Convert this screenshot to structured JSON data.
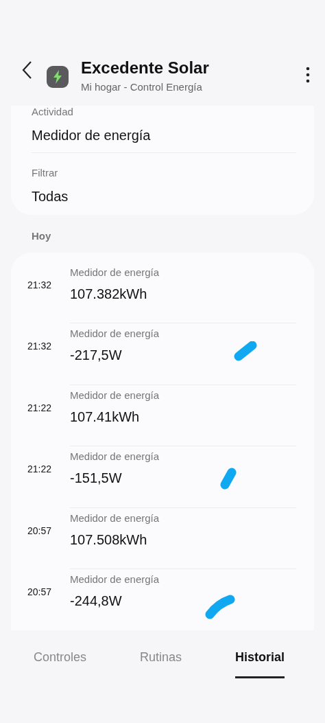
{
  "header": {
    "title": "Excedente Solar",
    "subtitle": "Mi hogar - Control Energía"
  },
  "filters": [
    {
      "label": "Actividad",
      "value": "Medidor de energía"
    },
    {
      "label": "Filtrar",
      "value": "Todas"
    }
  ],
  "section": "Hoy",
  "events": [
    {
      "time": "21:32",
      "label": "Medidor de energía",
      "value": "107.382kWh",
      "scribble": false
    },
    {
      "time": "21:32",
      "label": "Medidor de energía",
      "value": "-217,5W",
      "scribble": true
    },
    {
      "time": "21:22",
      "label": "Medidor de energía",
      "value": "107.41kWh",
      "scribble": false
    },
    {
      "time": "21:22",
      "label": "Medidor de energía",
      "value": "-151,5W",
      "scribble": true
    },
    {
      "time": "20:57",
      "label": "Medidor de energía",
      "value": "107.508kWh",
      "scribble": false
    },
    {
      "time": "20:57",
      "label": "Medidor de energía",
      "value": "-244,8W",
      "scribble": true
    }
  ],
  "tabs": [
    {
      "label": "Controles",
      "selected": false
    },
    {
      "label": "Rutinas",
      "selected": false
    },
    {
      "label": "Historial",
      "selected": true
    }
  ]
}
